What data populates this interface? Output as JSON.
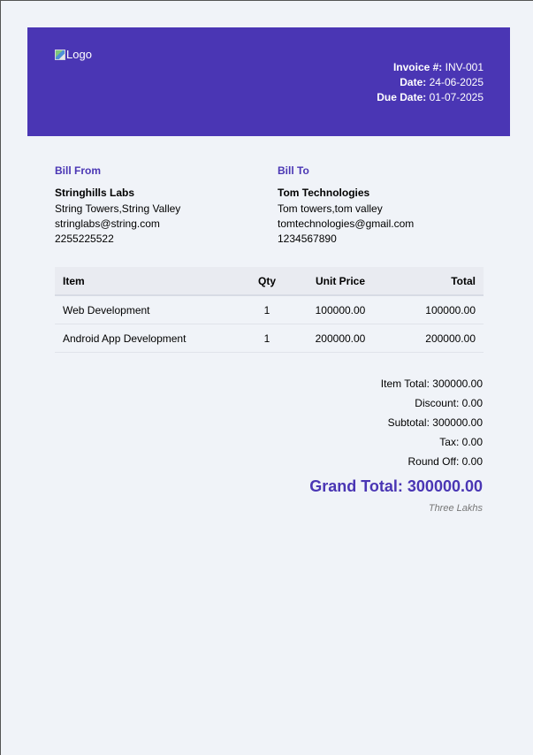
{
  "header": {
    "logo_alt": "Logo",
    "invoice_label": "Invoice #:",
    "invoice_number": "INV-001",
    "date_label": "Date:",
    "date": "24-06-2025",
    "due_label": "Due Date:",
    "due_date": "01-07-2025",
    "bg_color": "#4a36b4"
  },
  "bill_from": {
    "title": "Bill From",
    "name": "Stringhills Labs",
    "address": "String Towers,String Valley",
    "email": "stringlabs@string.com",
    "phone": "2255225522"
  },
  "bill_to": {
    "title": "Bill To",
    "name": "Tom Technologies",
    "address": "Tom towers,tom valley",
    "email": "tomtechnologies@gmail.com",
    "phone": "1234567890"
  },
  "table": {
    "headers": [
      "Item",
      "Qty",
      "Unit Price",
      "Total"
    ],
    "rows": [
      [
        "Web Development",
        "1",
        "100000.00",
        "100000.00"
      ],
      [
        "Android App Development",
        "1",
        "200000.00",
        "200000.00"
      ]
    ]
  },
  "totals": {
    "item_total": "Item Total: 300000.00",
    "discount": "Discount: 0.00",
    "subtotal": "Subtotal: 300000.00",
    "tax": "Tax: 0.00",
    "round_off": "Round Off: 0.00",
    "grand_total": "Grand Total: 300000.00",
    "amount_in_words": "Three Lakhs"
  },
  "colors": {
    "accent": "#4a36b4",
    "page_bg": "#f0f3f8"
  }
}
